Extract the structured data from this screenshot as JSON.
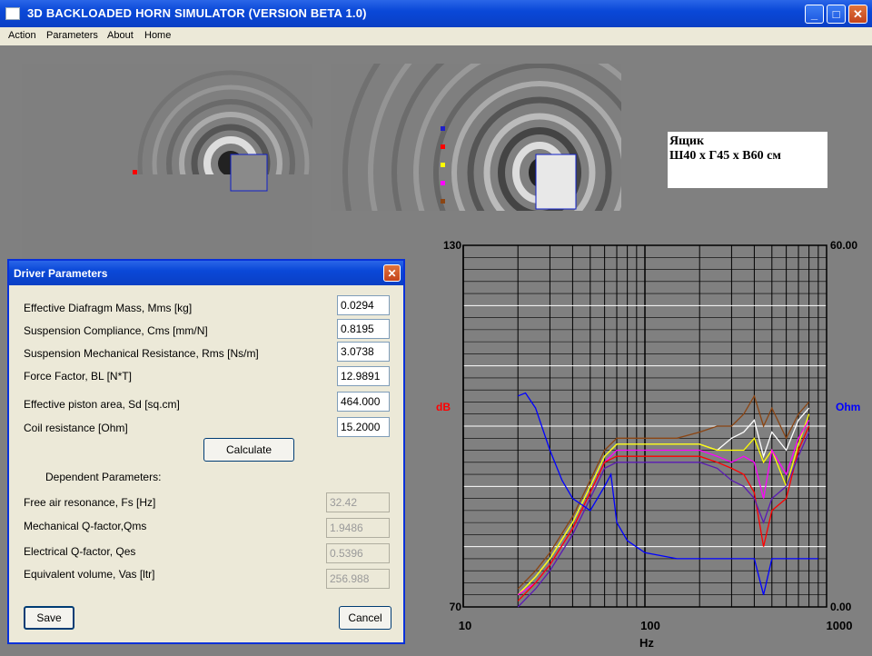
{
  "window": {
    "title": "3D BACKLOADED HORN SIMULATOR (VERSION BETA 1.0)",
    "buttons": [
      "_",
      "□",
      "✕"
    ]
  },
  "menu": [
    "Action",
    "Parameters",
    "About",
    "Home"
  ],
  "box_label": [
    "Ящик",
    "Ш40 х Г45 х В60 см"
  ],
  "dialog": {
    "title": "Driver Parameters",
    "close": "✕",
    "params": [
      {
        "label": "Effective Diafragm Mass, Mms [kg]",
        "value": "0.0294"
      },
      {
        "label": "Suspension Compliance, Cms [mm/N]",
        "value": "0.8195"
      },
      {
        "label": "Suspension Mechanical Resistance, Rms  [Ns/m]",
        "value": "3.0738"
      },
      {
        "label": "Force Factor, BL [N*T]",
        "value": "12.9891"
      },
      {
        "label": "Effective piston area, Sd [sq.cm]",
        "value": "464.000"
      },
      {
        "label": "Coil resistance [Ohm]",
        "value": "15.2000"
      }
    ],
    "calculate": "Calculate",
    "dependent_header": "Dependent Parameters:",
    "dependent": [
      {
        "label": "Free air resonance, Fs [Hz]",
        "value": "32.42"
      },
      {
        "label": "Mechanical Q-factor,Qms",
        "value": "1.9486"
      },
      {
        "label": "Electrical Q-factor, Qes",
        "value": "0.5396"
      },
      {
        "label": "Equivalent volume, Vas [ltr]",
        "value": "256.988"
      }
    ],
    "save": "Save",
    "cancel": "Cancel"
  },
  "chart_data": {
    "type": "line",
    "xscale": "log",
    "xlim": [
      10,
      1000
    ],
    "ylim": [
      70,
      130
    ],
    "y2lim": [
      0,
      60
    ],
    "xticks": [
      "10",
      "100",
      "1000"
    ],
    "xlabel": "Hz",
    "ylabel": "dB",
    "y2label": "Ohm",
    "ymin_label": "70",
    "ymax_label": "130",
    "y2min_label": "0.00",
    "y2max_label": "60.00",
    "colors": {
      "red": "#ff0000",
      "yellow": "#ffff00",
      "white": "#ffffff",
      "magenta": "#ff00ff",
      "brown": "#8b4513",
      "purple": "#5a1ab4",
      "blue": "#0000ff"
    },
    "series": [
      {
        "color": "brown",
        "axis": "left",
        "x": [
          20,
          25,
          30,
          40,
          50,
          60,
          70,
          80,
          100,
          150,
          200,
          250,
          300,
          350,
          400,
          450,
          500,
          600,
          700,
          800
        ],
        "y": [
          73,
          76,
          79,
          85,
          91,
          96,
          98,
          98,
          98,
          98,
          99,
          100,
          100,
          102,
          105,
          100,
          103,
          98,
          102,
          104
        ]
      },
      {
        "color": "white",
        "axis": "left",
        "x": [
          20,
          25,
          30,
          40,
          50,
          60,
          70,
          80,
          100,
          150,
          200,
          250,
          300,
          350,
          400,
          450,
          500,
          600,
          700,
          800
        ],
        "y": [
          72,
          75,
          78,
          84,
          90,
          95,
          97,
          97,
          97,
          97,
          97,
          96,
          98,
          99,
          101,
          95,
          99,
          96,
          101,
          103
        ]
      },
      {
        "color": "yellow",
        "axis": "left",
        "x": [
          20,
          25,
          30,
          40,
          50,
          60,
          70,
          80,
          100,
          150,
          200,
          250,
          300,
          350,
          400,
          450,
          500,
          600,
          700,
          800
        ],
        "y": [
          72,
          75,
          78,
          84,
          90,
          95,
          97,
          97,
          97,
          97,
          97,
          96,
          96,
          96,
          98,
          94,
          96,
          90,
          97,
          102
        ]
      },
      {
        "color": "magenta",
        "axis": "left",
        "x": [
          20,
          25,
          30,
          40,
          50,
          60,
          70,
          80,
          100,
          150,
          200,
          250,
          300,
          350,
          400,
          450,
          500,
          600,
          700,
          800
        ],
        "y": [
          72,
          74,
          77,
          83,
          89,
          94,
          96,
          96,
          96,
          96,
          96,
          95,
          94,
          95,
          94,
          88,
          96,
          92,
          98,
          101
        ]
      },
      {
        "color": "red",
        "axis": "left",
        "x": [
          20,
          25,
          30,
          40,
          50,
          60,
          70,
          80,
          100,
          150,
          200,
          250,
          300,
          350,
          400,
          450,
          500,
          600,
          700,
          800
        ],
        "y": [
          71,
          74,
          77,
          83,
          89,
          94,
          95,
          95,
          95,
          95,
          95,
          94,
          93,
          92,
          89,
          80,
          86,
          88,
          96,
          100
        ]
      },
      {
        "color": "purple",
        "axis": "left",
        "x": [
          20,
          25,
          30,
          40,
          50,
          60,
          70,
          80,
          100,
          150,
          200,
          250,
          300,
          350,
          400,
          450,
          500,
          600,
          700,
          800
        ],
        "y": [
          70,
          73,
          76,
          82,
          88,
          93,
          94,
          94,
          94,
          94,
          94,
          93,
          91,
          90,
          88,
          84,
          88,
          90,
          95,
          99
        ]
      },
      {
        "color": "blue",
        "axis": "right",
        "x": [
          20,
          22,
          25,
          30,
          35,
          40,
          50,
          60,
          65,
          70,
          80,
          100,
          150,
          200,
          300,
          400,
          450,
          500,
          700,
          900
        ],
        "y": [
          35,
          35.5,
          33,
          26,
          21,
          18,
          16,
          20,
          22,
          14,
          11,
          9,
          8,
          8,
          8,
          8,
          2,
          8,
          8,
          8
        ]
      }
    ]
  }
}
